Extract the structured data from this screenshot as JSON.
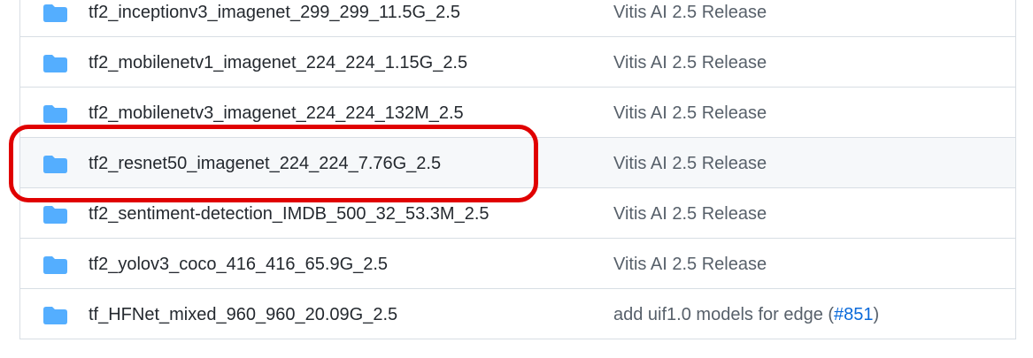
{
  "files": [
    {
      "name": "tf2_inceptionv3_imagenet_299_299_11.5G_2.5",
      "message": "Vitis AI 2.5 Release",
      "icon": "folder-icon"
    },
    {
      "name": "tf2_mobilenetv1_imagenet_224_224_1.15G_2.5",
      "message": "Vitis AI 2.5 Release",
      "icon": "folder-icon"
    },
    {
      "name": "tf2_mobilenetv3_imagenet_224_224_132M_2.5",
      "message": "Vitis AI 2.5 Release",
      "icon": "folder-icon"
    },
    {
      "name": "tf2_resnet50_imagenet_224_224_7.76G_2.5",
      "message": "Vitis AI 2.5 Release",
      "icon": "folder-icon"
    },
    {
      "name": "tf2_sentiment-detection_IMDB_500_32_53.3M_2.5",
      "message": "Vitis AI 2.5 Release",
      "icon": "folder-icon"
    },
    {
      "name": "tf2_yolov3_coco_416_416_65.9G_2.5",
      "message": "Vitis AI 2.5 Release",
      "icon": "folder-icon"
    },
    {
      "name": "tf_HFNet_mixed_960_960_20.09G_2.5",
      "message_prefix": "add uif1.0 models for edge (",
      "message_link": "#851",
      "message_suffix": ")",
      "icon": "folder-icon"
    }
  ],
  "colors": {
    "folder": "#54aeff",
    "link": "#0969da",
    "annotation": "#e00000",
    "highlight_row_bg": "#f6f8fa"
  }
}
